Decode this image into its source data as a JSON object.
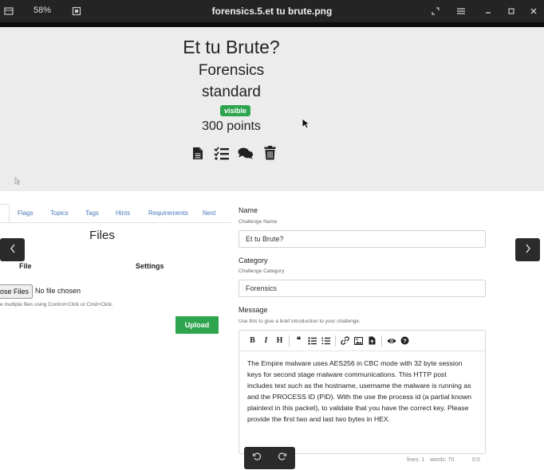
{
  "viewer": {
    "title": "forensics.5.et tu brute.png",
    "zoom": "58%"
  },
  "challenge": {
    "name": "Et tu Brute?",
    "category": "Forensics",
    "type": "standard",
    "state": "visible",
    "points": "300 points"
  },
  "nav": {
    "items": [
      "Flags",
      "Topics",
      "Tags",
      "Hints",
      "Requirements",
      "Next"
    ]
  },
  "files": {
    "title": "Files",
    "col_file": "File",
    "col_settings": "Settings",
    "choose_label": "oose Files",
    "no_file": "No file chosen",
    "help": "e multiple files using Control+Click or Cmd+Click.",
    "upload_label": "Upload"
  },
  "form": {
    "name_label": "Name",
    "name_help": "Challenge Name",
    "name_value": "Et tu Brute?",
    "category_label": "Category",
    "category_help": "Challenge Category",
    "category_value": "Forensics",
    "message_label": "Message",
    "message_help": "Use this to give a brief introduction to your challenge.",
    "message_lines": [
      "The Empire malware uses AES256 in CBC mode with 32 byte session",
      "keys for second stage malware communications.  This HTTP post",
      "includes text such as the hostname, username the malware is running as",
      "and the PROCESS ID (PID). With the use the process id (a partial known",
      "plaintext in this packet), to validate that you have the correct key.  Please",
      "provide the first two and last two bytes in HEX."
    ],
    "status_lines": "lines: 1",
    "status_words": "words: 70",
    "status_pos": "0:0"
  },
  "colors": {
    "accent_green": "#2ea44f",
    "titlebar": "#242424",
    "link_blue": "#4a79b8"
  }
}
